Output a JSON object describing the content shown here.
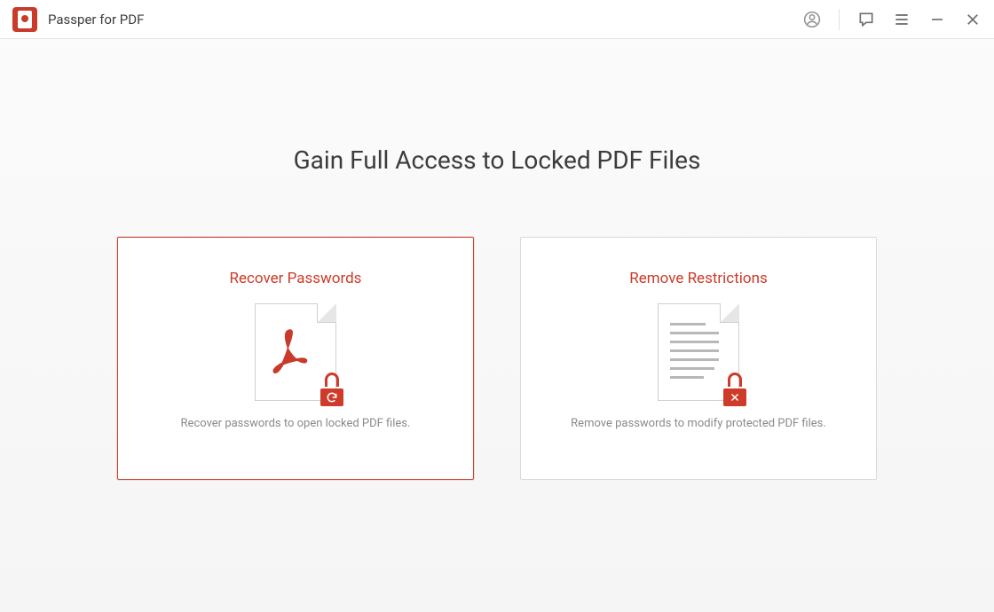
{
  "app": {
    "title": "Passper for PDF"
  },
  "main": {
    "headline": "Gain Full Access to Locked PDF Files"
  },
  "cards": {
    "recover": {
      "title": "Recover Passwords",
      "desc": "Recover passwords to open locked PDF files."
    },
    "remove": {
      "title": "Remove Restrictions",
      "desc": "Remove passwords to modify protected PDF files."
    }
  }
}
